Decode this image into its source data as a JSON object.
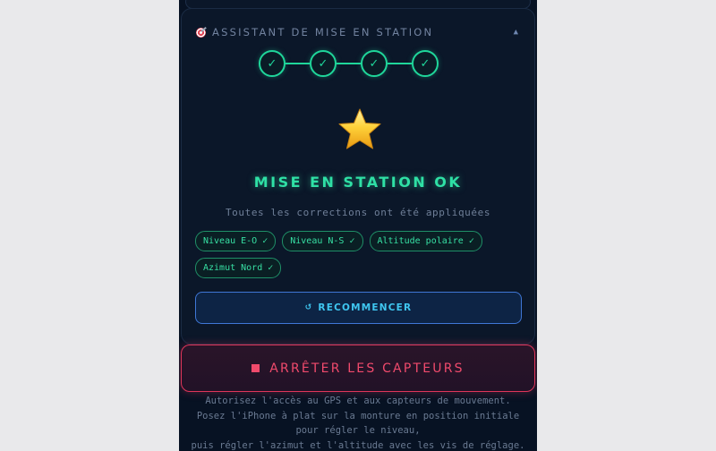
{
  "assistant": {
    "title": "ASSISTANT DE MISE EN STATION",
    "collapse_icon": "chevron-up-icon",
    "steps": [
      {
        "symbol": "✓",
        "status": "done"
      },
      {
        "symbol": "✓",
        "status": "done"
      },
      {
        "symbol": "✓",
        "status": "done"
      },
      {
        "symbol": "✓",
        "status": "done"
      }
    ],
    "success_icon": "star-icon",
    "success_title": "MISE EN STATION OK",
    "success_subtitle": "Toutes les corrections ont été appliquées",
    "chips": [
      "Niveau E-O ✓",
      "Niveau N-S ✓",
      "Altitude polaire ✓",
      "Azimut Nord ✓"
    ],
    "restart_icon": "↺",
    "restart_label": "RECOMMENCER"
  },
  "stop_button": {
    "label": "ARRÊTER LES CAPTEURS"
  },
  "instructions": {
    "lines": [
      "Autorisez l'accès au GPS et aux capteurs de mouvement.",
      "Posez l'iPhone à plat sur la monture en position initiale",
      "pour régler le niveau,",
      "puis régler l'azimut et l'altitude avec les vis de réglage."
    ]
  },
  "colors": {
    "success": "#1fd69a",
    "accent_blue": "#3fc6f0",
    "danger": "#f04a6c",
    "background": "#071223"
  }
}
